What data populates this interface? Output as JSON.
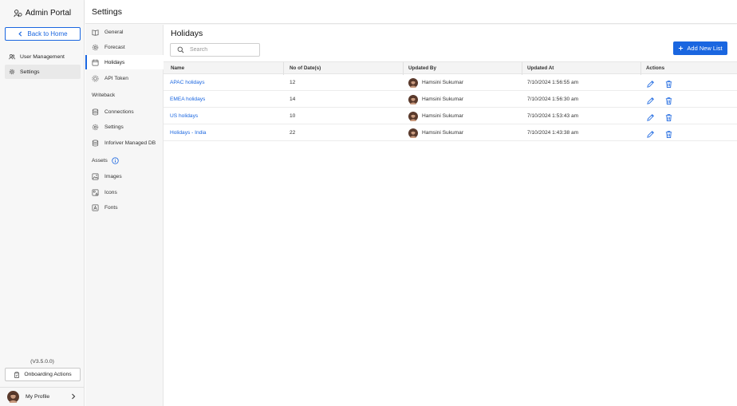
{
  "app": {
    "title": "Admin Portal"
  },
  "sidebar": {
    "back_label": "Back to Home",
    "items": [
      {
        "label": "User Management",
        "icon": "users-icon"
      },
      {
        "label": "Settings",
        "icon": "gear-icon"
      }
    ],
    "version": "(V3.5.0.0)",
    "onboarding_label": "Onboarding Actions",
    "profile_label": "My Profile"
  },
  "header": {
    "title": "Settings"
  },
  "subnav": {
    "items": [
      {
        "label": "General",
        "icon": "book-icon"
      },
      {
        "label": "Forecast",
        "icon": "gear-icon"
      },
      {
        "label": "Holidays",
        "icon": "calendar-icon"
      },
      {
        "label": "API Token",
        "icon": "api-icon"
      }
    ],
    "writeback_heading": "Writeback",
    "writeback_items": [
      {
        "label": "Connections",
        "icon": "database-icon"
      },
      {
        "label": "Settings",
        "icon": "gear-icon"
      },
      {
        "label": "Inforiver Managed DB",
        "icon": "database-icon"
      }
    ],
    "assets_heading": "Assets",
    "assets_items": [
      {
        "label": "Images",
        "icon": "image-icon"
      },
      {
        "label": "Icons",
        "icon": "shapes-icon"
      },
      {
        "label": "Fonts",
        "icon": "font-icon"
      }
    ]
  },
  "main": {
    "title": "Holidays",
    "search_placeholder": "Search",
    "add_button_label": "Add New List",
    "columns": [
      "Name",
      "No of Date(s)",
      "Updated By",
      "Updated At",
      "Actions"
    ],
    "rows": [
      {
        "name": "APAC holidays",
        "count": "12",
        "updated_by": "Hamsini Sukumar",
        "updated_at": "7/10/2024 1:56:55 am"
      },
      {
        "name": "EMEA holidays",
        "count": "14",
        "updated_by": "Hamsini Sukumar",
        "updated_at": "7/10/2024 1:56:30 am"
      },
      {
        "name": "US holidays",
        "count": "10",
        "updated_by": "Hamsini Sukumar",
        "updated_at": "7/10/2024 1:53:43 am"
      },
      {
        "name": "Holidays - India",
        "count": "22",
        "updated_by": "Hamsini Sukumar",
        "updated_at": "7/10/2024 1:43:38 am"
      }
    ]
  },
  "colors": {
    "accent": "#1a66e0",
    "sidebar_bg": "#f7f7f7"
  }
}
